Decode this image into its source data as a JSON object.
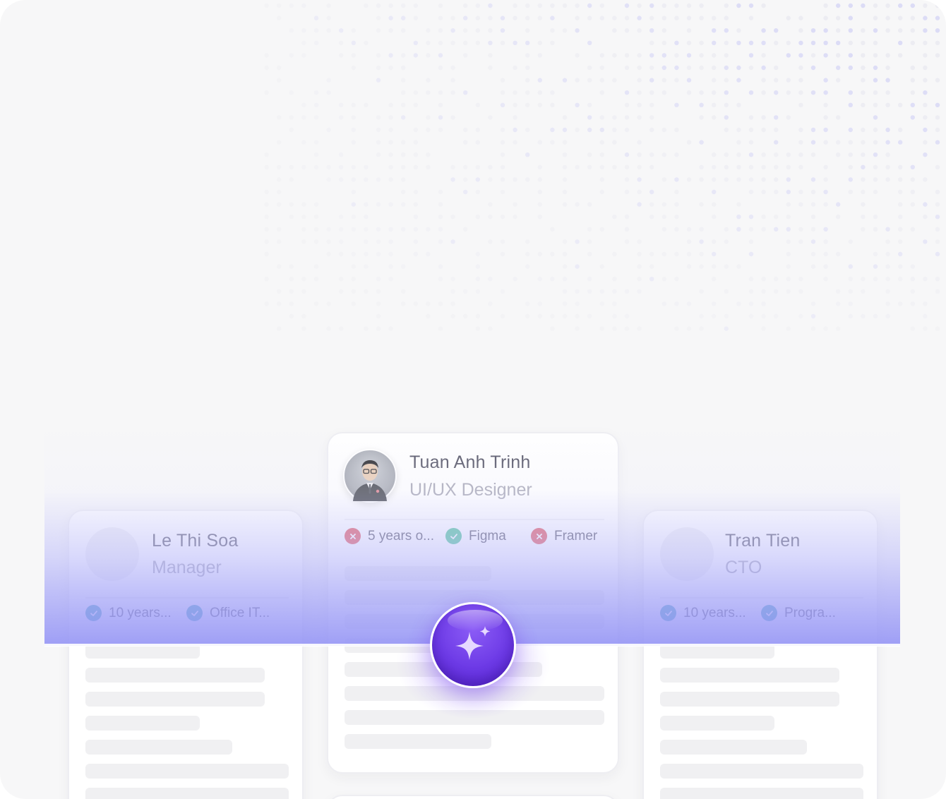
{
  "cards": {
    "left": {
      "name": "Le Thi Soa",
      "role": "Manager",
      "tags": [
        {
          "label": "10 years...",
          "status": "ok"
        },
        {
          "label": "Office IT...",
          "status": "ok"
        }
      ]
    },
    "center": {
      "name": "Tuan Anh Trinh",
      "role": "UI/UX Designer",
      "tags": [
        {
          "label": "5 years o...",
          "status": "fail"
        },
        {
          "label": "Figma",
          "status": "ok"
        },
        {
          "label": "Framer",
          "status": "fail"
        }
      ]
    },
    "right": {
      "name": "Tran Tien",
      "role": "CTO",
      "tags": [
        {
          "label": "10 years...",
          "status": "ok"
        },
        {
          "label": "Progra...",
          "status": "ok"
        }
      ]
    }
  },
  "icons": {
    "check": "check-icon",
    "cross": "x-icon",
    "ai": "sparkle-icon"
  },
  "colors": {
    "accent": "#6d3ae6",
    "ok_teal": "#2f9fb3",
    "ok_green": "#3fbf8f",
    "fail_red": "#e0474f"
  }
}
